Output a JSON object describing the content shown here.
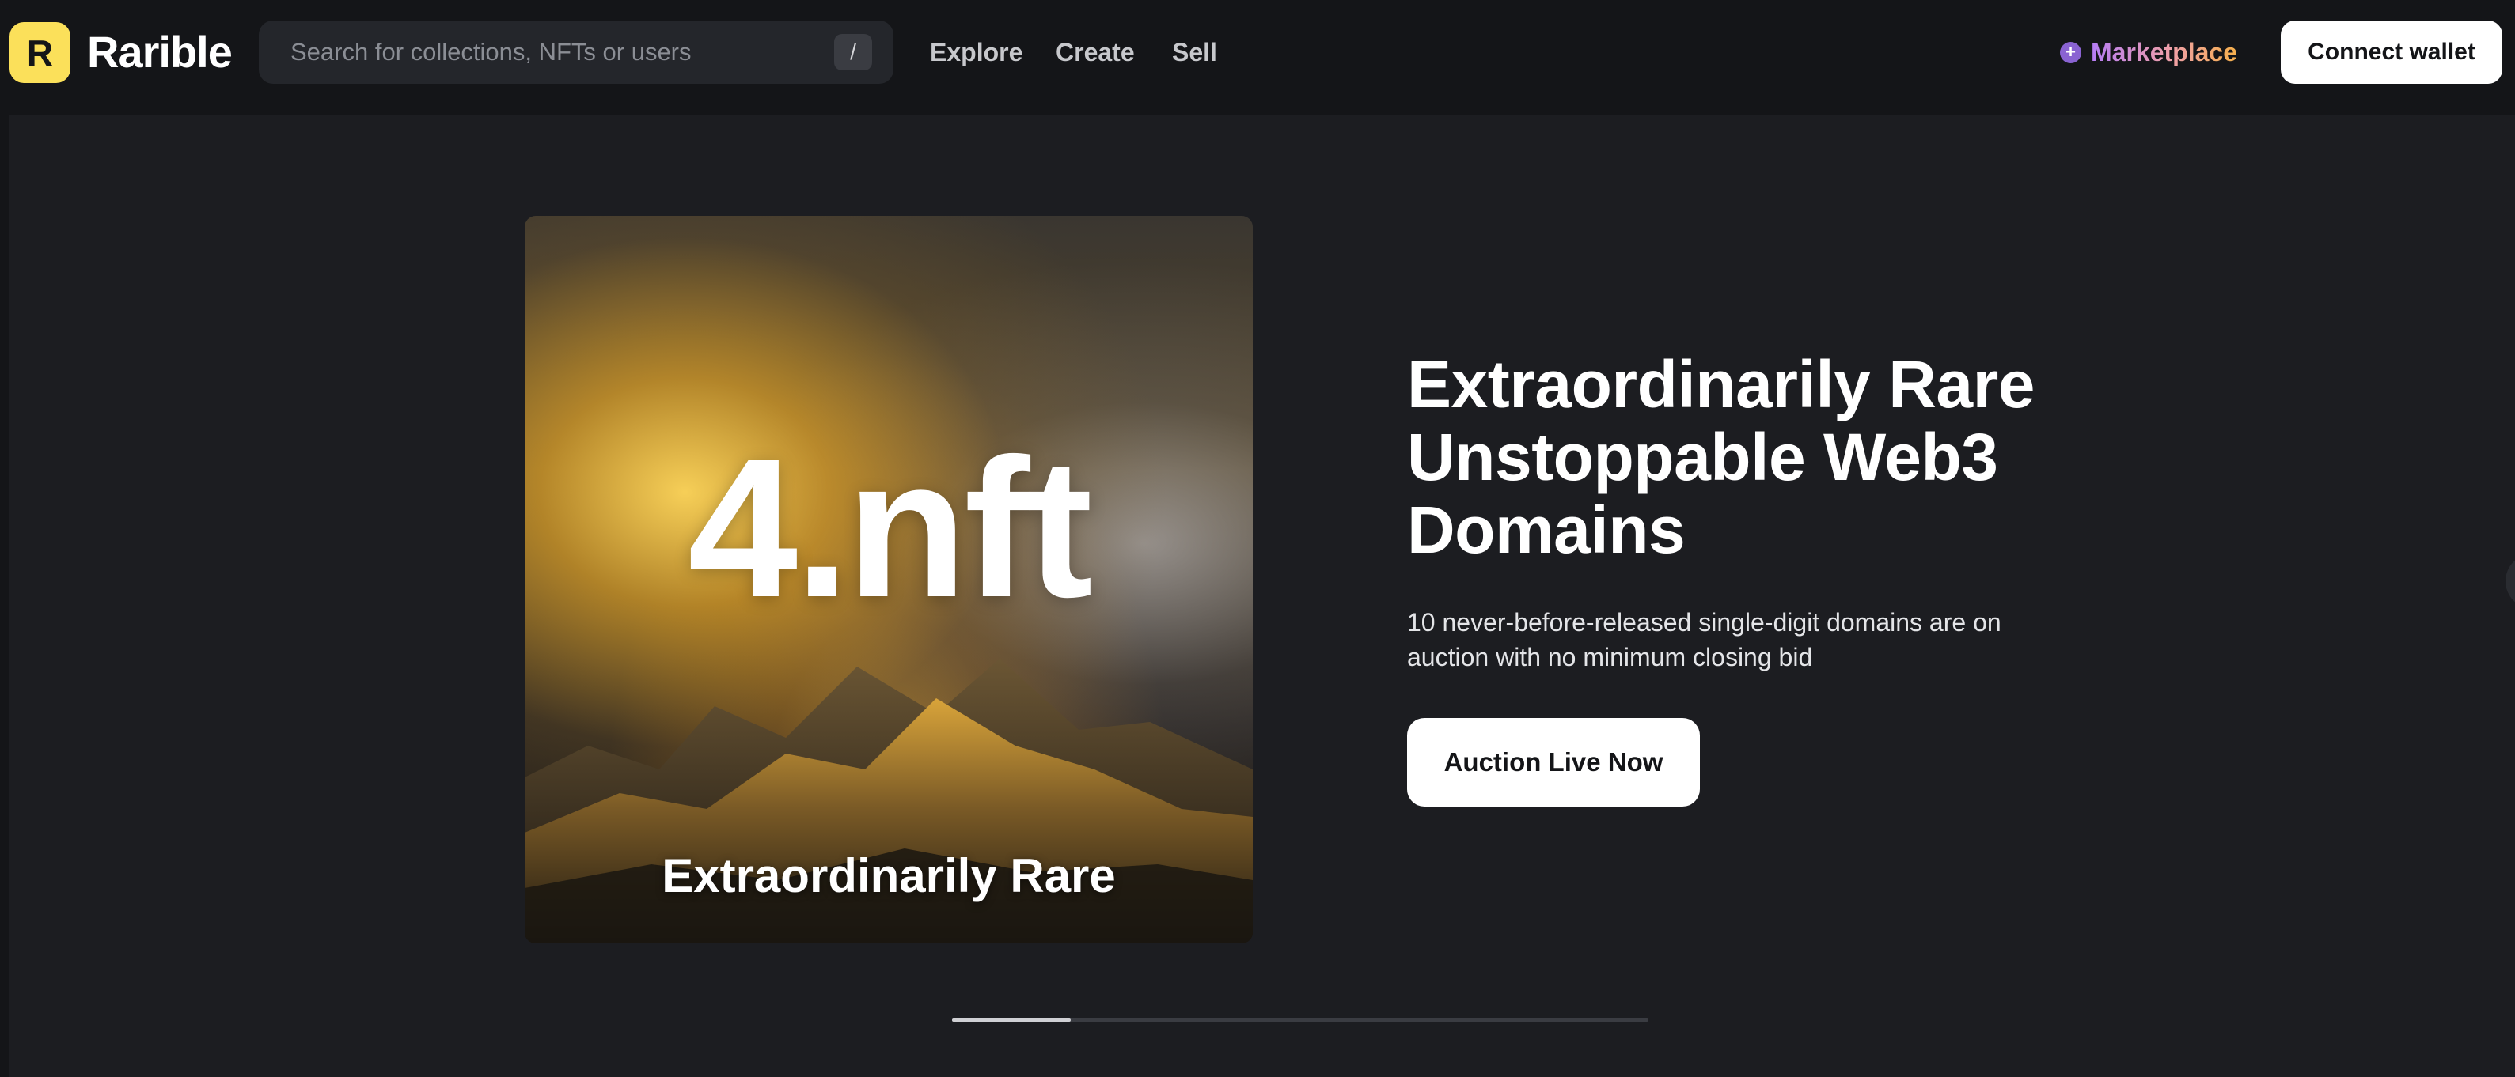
{
  "header": {
    "logo_letter": "R",
    "brand": "Rarible",
    "search": {
      "placeholder": "Search for collections, NFTs or users",
      "value": "",
      "shortcut": "/"
    },
    "nav": [
      {
        "label": "Explore"
      },
      {
        "label": "Create"
      },
      {
        "label": "Sell"
      }
    ],
    "marketplace": {
      "icon": "plus-circle-icon",
      "icon_glyph": "+",
      "label": "Marketplace"
    },
    "connect_wallet": "Connect wallet"
  },
  "hero": {
    "artwork": {
      "title": "4.nft",
      "caption": "Extraordinarily Rare"
    },
    "headline": "Extraordinarily Rare Unstoppable Web3 Domains",
    "description": "10 never-before-released single-digit domains are on auction with no minimum closing bid",
    "cta": "Auction Live Now",
    "carousel_progress": 0.17
  },
  "colors": {
    "background": "#141518",
    "hero_background": "#1c1d21",
    "logo": "#fbe05a",
    "marketplace_gradient": [
      "#b57cf5",
      "#f0a0a8",
      "#f6b04c"
    ]
  }
}
